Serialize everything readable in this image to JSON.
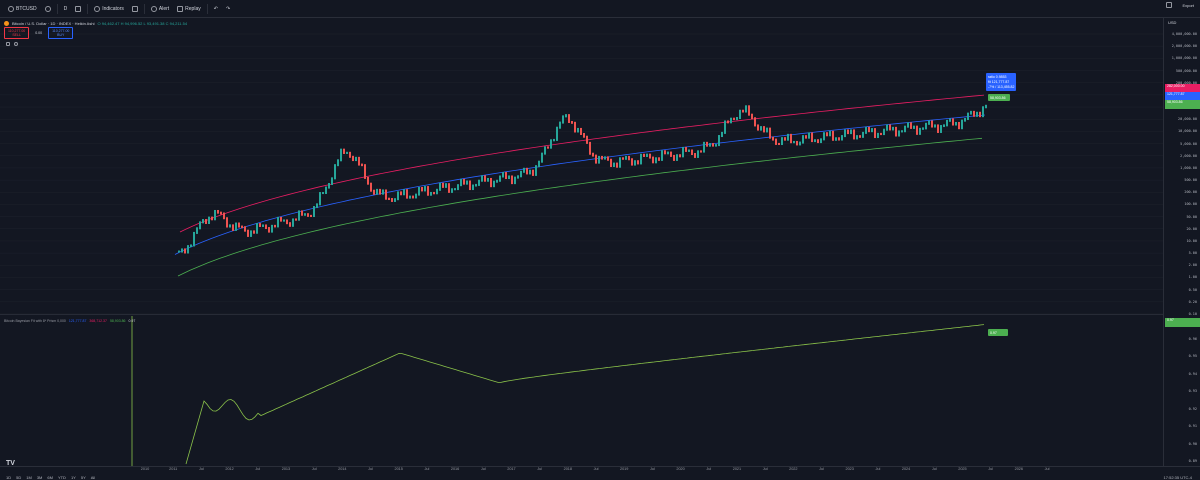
{
  "toolbar": {
    "symbol": "BTCUSD",
    "interval": "D",
    "indicators_label": "Indicators",
    "alert_label": "Alert",
    "replay_label": "Replay",
    "publish_label": "Export"
  },
  "legend": {
    "title": "Bitcoin / U.S. Dollar · 1D · INDEX · Heikin Ashi",
    "ohlc": "O 94,462.47  H 94,996.52  L 93,491.38  C 94,211.54",
    "sell_price": "110,277.00",
    "sell_label": "SELL",
    "mid_value": "0.00",
    "buy_price": "110,277.00",
    "buy_label": "BUY"
  },
  "indicator": {
    "name": "Bitcoin Bayesian Fit with 8* Prism 0,000",
    "val_blue": "121,777.87",
    "val_pink": "368,712.37",
    "val_green": "58,903.86",
    "val_white": "0.97"
  },
  "price_scale": {
    "mode_label": "USD",
    "ticks": [
      "4,000,000.00",
      "2,000,000.00",
      "1,000,000.00",
      "500,000.00",
      "200,000.00",
      "100,000.00",
      "50,000.00",
      "20,000.00",
      "10,000.00",
      "5,000.00",
      "2,000.00",
      "1,000.00",
      "500.00",
      "200.00",
      "100.00",
      "50.00",
      "20.00",
      "10.00",
      "5.00",
      "2.00",
      "1.00",
      "0.50",
      "0.20",
      "0.10"
    ],
    "badge_pink": "282,000.00",
    "badge_blue": "121,777.87",
    "badge_green": "58,903.86",
    "ind_ticks": [
      "0.97",
      "0.96",
      "0.95",
      "0.94",
      "0.93",
      "0.92",
      "0.91",
      "0.90",
      "0.89"
    ],
    "badge_ind": "0.97"
  },
  "callouts": {
    "blue_box_1": "ratio 0.9853",
    "blue_box_2": "fit 121,777.87",
    "blue_box_3": "-7% / 113,455.82",
    "green_box": "58,903.86",
    "ind_box": "0.97"
  },
  "time_axis": {
    "ticks": [
      "2010",
      "2011",
      "Jul",
      "2012",
      "Jul",
      "2013",
      "Jul",
      "2014",
      "Jul",
      "2015",
      "Jul",
      "2016",
      "Jul",
      "2017",
      "Jul",
      "2018",
      "Jul",
      "2019",
      "Jul",
      "2020",
      "Jul",
      "2021",
      "Jul",
      "2022",
      "Jul",
      "2023",
      "Jul",
      "2024",
      "Jul",
      "2025",
      "Jul",
      "2026",
      "Jul"
    ],
    "ranges": [
      "1D",
      "5D",
      "1M",
      "3M",
      "6M",
      "YTD",
      "1Y",
      "5Y",
      "All"
    ],
    "clock": "17:52:35 UTC-4"
  },
  "colors": {
    "background": "#131722",
    "upper_band": "#e91e63",
    "fit_line": "#2962ff",
    "lower_band": "#4caf50",
    "candle_up": "#26a69a",
    "candle_down": "#ef5350",
    "indicator_line": "#8bc34a"
  }
}
